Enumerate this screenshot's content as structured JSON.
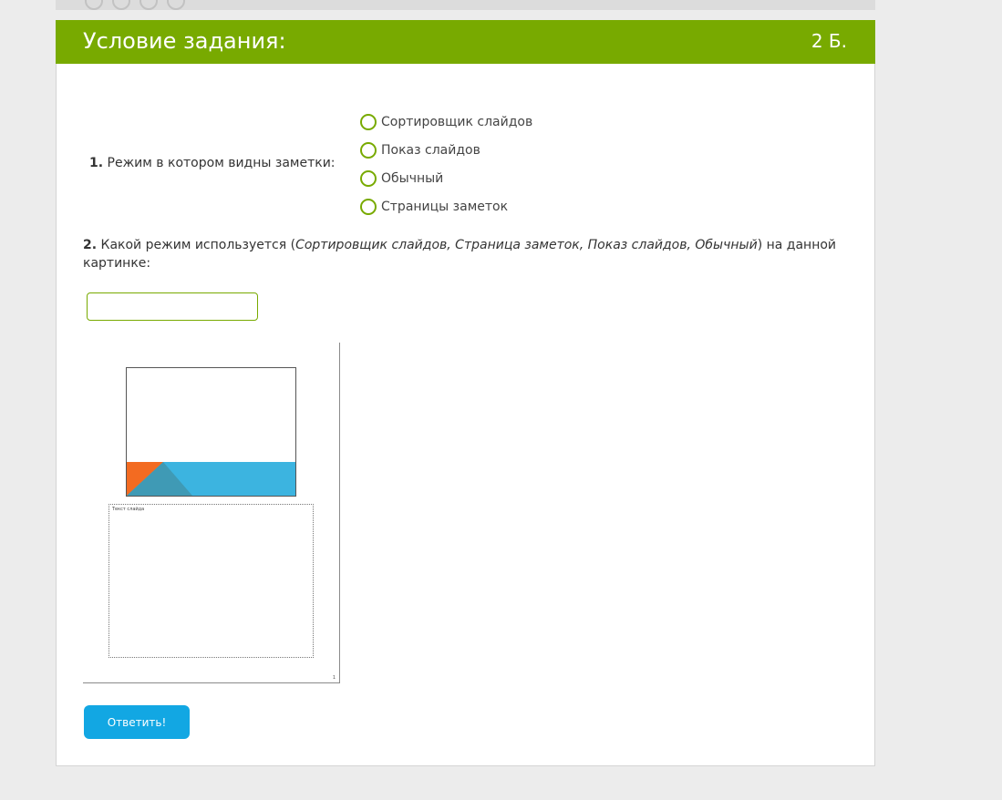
{
  "task": {
    "header_title": "Условие задания:",
    "points": "2 Б."
  },
  "question1": {
    "number": "1.",
    "text": "Режим в котором видны заметки:",
    "options": [
      {
        "label": "Сортировщик слайдов"
      },
      {
        "label": "Показ слайдов"
      },
      {
        "label": "Обычный"
      },
      {
        "label": "Страницы заметок"
      }
    ]
  },
  "question2": {
    "number": "2.",
    "text_before": "Какой режим используется (",
    "text_italic": "Сортировщик слайдов, Страница заметок, Показ слайдов, Обычный",
    "text_after": ") на данной картинке:",
    "answer_value": "",
    "answer_placeholder": ""
  },
  "picture": {
    "notes_placeholder_text": "Текст слайда",
    "page_number": "1"
  },
  "submit": {
    "label": "Ответить!"
  },
  "colors": {
    "header": "#78aa00",
    "radio_border": "#78aa00",
    "submit_button": "#12a7e3",
    "slide_orange": "#f36b21",
    "slide_blue": "#3cb4e0",
    "slide_darkblue": "#3f9ab5"
  }
}
